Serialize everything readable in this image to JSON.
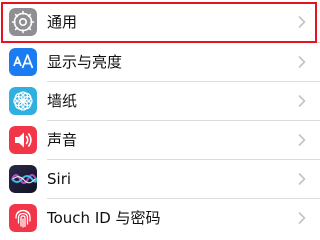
{
  "settings": {
    "items": [
      {
        "label": "通用",
        "icon": "gear-icon",
        "color": "#8e8e93"
      },
      {
        "label": "显示与亮度",
        "icon": "text-size-icon",
        "color": "#1a7cf0"
      },
      {
        "label": "墙纸",
        "icon": "flower-icon",
        "color": "#30b0e0"
      },
      {
        "label": "声音",
        "icon": "speaker-icon",
        "color": "#f2364a"
      },
      {
        "label": "Siri",
        "icon": "siri-icon",
        "color": "#1c1c3c"
      },
      {
        "label": "Touch ID 与密码",
        "icon": "fingerprint-icon",
        "color": "#f2364a"
      }
    ]
  },
  "highlight": {
    "color": "#e5121f",
    "target": "通用"
  }
}
